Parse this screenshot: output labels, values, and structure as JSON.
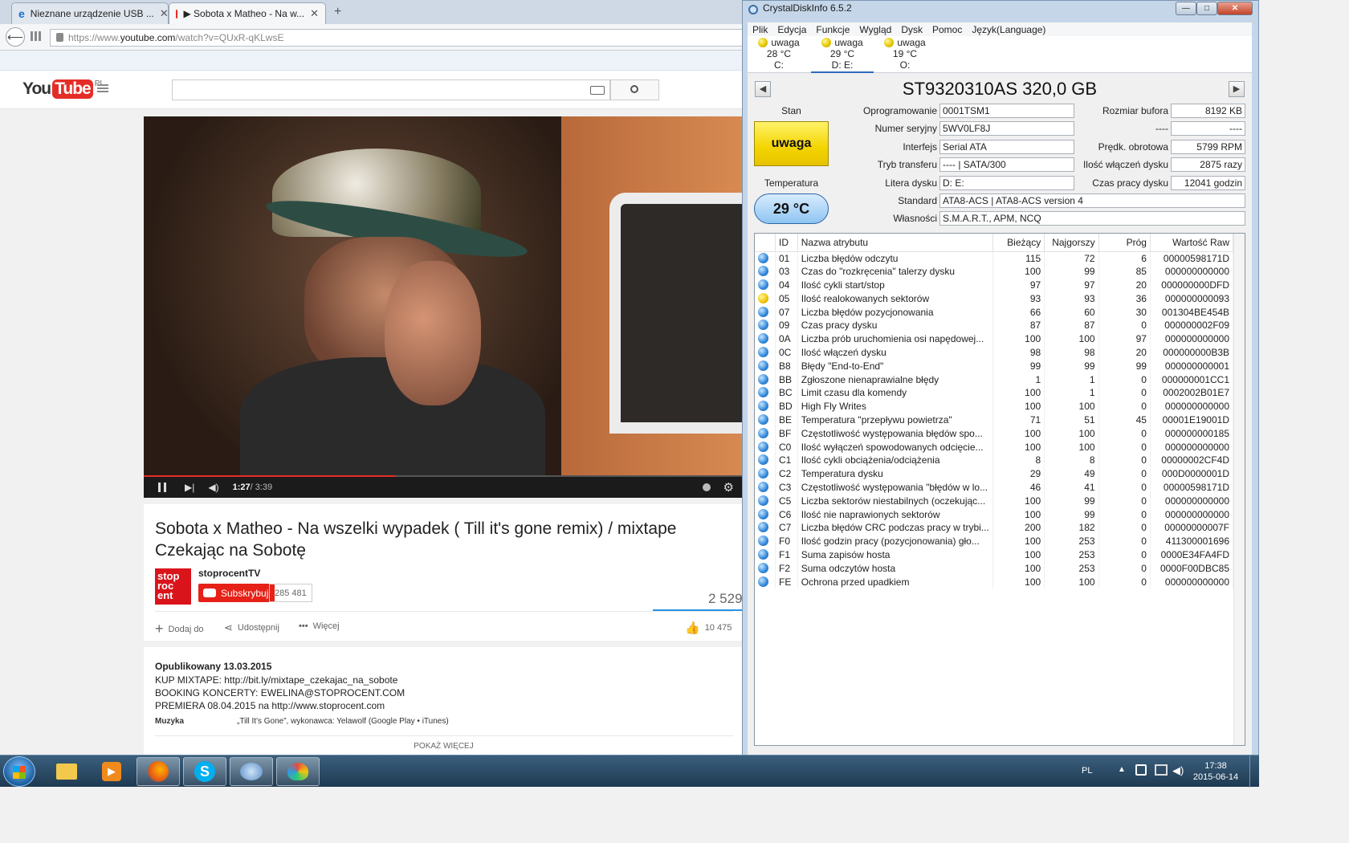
{
  "browser": {
    "tabs": [
      {
        "label": "Nieznane urządzenie USB ...",
        "close": "✕"
      },
      {
        "label": "▶ Sobota x Matheo - Na w...",
        "close": "✕"
      }
    ],
    "new_tab": "+",
    "url_prefix": "https://www.",
    "url_domain": "youtube.com",
    "url_path": "/watch?v=QUxR-qKLwsE"
  },
  "youtube": {
    "logo_you": "You",
    "logo_tube": "Tube",
    "logo_region": "PL",
    "time_current": "1:27",
    "time_total": " / 3:39",
    "progress": 0.42,
    "video_title": "Sobota x Matheo - Na wszelki wypadek ( Till it's gone remix) / mixtape Czekając na Sobotę",
    "channel_name": "stoprocentTV",
    "channel_logo": "stop roc ent",
    "subscribe_label": "Subskrybuj",
    "subscriber_count": "285 481",
    "views": "2 529",
    "add_label": "Dodaj do",
    "share_label": "Udostępnij",
    "more_label": "Więcej",
    "likes": "10 475",
    "published": "Opublikowany 13.03.2015",
    "desc_lines": [
      "KUP MIXTAPE: http://bit.ly/mixtape_czekajac_na_sobote",
      "BOOKING KONCERTY: EWELINA@STOPROCENT.COM",
      "PREMIERA 08.04.2015 na http://www.stoprocent.com"
    ],
    "music_label": "Muzyka",
    "music_value": "„Till It's Gone”, wykonawca: Yelawolf (Google Play • iTunes)",
    "show_more": "POKAŻ WIĘCEJ"
  },
  "cdi": {
    "title": "CrystalDiskInfo 6.5.2",
    "menu": [
      "Plik",
      "Edycja",
      "Funkcje",
      "Wygląd",
      "Dysk",
      "Pomoc",
      "Język(Language)"
    ],
    "drives": [
      {
        "status": "uwaga",
        "temp": "28 °C",
        "letter": "C:"
      },
      {
        "status": "uwaga",
        "temp": "29 °C",
        "letter": "D: E:"
      },
      {
        "status": "uwaga",
        "temp": "19 °C",
        "letter": "O:"
      }
    ],
    "disk_title": "ST9320310AS 320,0 GB",
    "stan_label": "Stan",
    "stan_value": "uwaga",
    "temp_label": "Temperatura",
    "temp_value": "29 °C",
    "fields": {
      "firmware_label": "Oprogramowanie",
      "firmware": "0001TSM1",
      "serial_label": "Numer seryjny",
      "serial": "5WV0LF8J",
      "interface_label": "Interfejs",
      "interface": "Serial ATA",
      "transfer_label": "Tryb transferu",
      "transfer": "---- | SATA/300",
      "letter_label": "Litera dysku",
      "letter": "D: E:",
      "standard_label": "Standard",
      "standard": "ATA8-ACS | ATA8-ACS version 4",
      "features_label": "Własności",
      "features": "S.M.A.R.T., APM, NCQ",
      "buffer_label": "Rozmiar bufora",
      "buffer": "8192 KB",
      "blank_label": "----",
      "blank": "----",
      "rpm_label": "Prędk. obrotowa",
      "rpm": "5799 RPM",
      "power_count_label": "Ilość włączeń dysku",
      "power_count": "2875 razy",
      "power_hours_label": "Czas pracy dysku",
      "power_hours": "12041 godzin"
    },
    "columns": [
      "ID",
      "Nazwa atrybutu",
      "Bieżący",
      "Najgorszy",
      "Próg",
      "Wartość Raw"
    ],
    "rows": [
      {
        "id": "01",
        "name": "Liczba błędów odczytu",
        "cur": "115",
        "worst": "72",
        "thr": "6",
        "raw": "00000598171D",
        "warn": false
      },
      {
        "id": "03",
        "name": "Czas do \"rozkręcenia\" talerzy dysku",
        "cur": "100",
        "worst": "99",
        "thr": "85",
        "raw": "000000000000",
        "warn": false
      },
      {
        "id": "04",
        "name": "Ilość cykli start/stop",
        "cur": "97",
        "worst": "97",
        "thr": "20",
        "raw": "000000000DFD",
        "warn": false
      },
      {
        "id": "05",
        "name": "Ilość realokowanych sektorów",
        "cur": "93",
        "worst": "93",
        "thr": "36",
        "raw": "000000000093",
        "warn": true
      },
      {
        "id": "07",
        "name": "Liczba błędów pozycjonowania",
        "cur": "66",
        "worst": "60",
        "thr": "30",
        "raw": "001304BE454B",
        "warn": false
      },
      {
        "id": "09",
        "name": "Czas pracy dysku",
        "cur": "87",
        "worst": "87",
        "thr": "0",
        "raw": "000000002F09",
        "warn": false
      },
      {
        "id": "0A",
        "name": "Liczba prób uruchomienia osi napędowej...",
        "cur": "100",
        "worst": "100",
        "thr": "97",
        "raw": "000000000000",
        "warn": false
      },
      {
        "id": "0C",
        "name": "Ilość włączeń dysku",
        "cur": "98",
        "worst": "98",
        "thr": "20",
        "raw": "000000000B3B",
        "warn": false
      },
      {
        "id": "B8",
        "name": "Błędy \"End-to-End\"",
        "cur": "99",
        "worst": "99",
        "thr": "99",
        "raw": "000000000001",
        "warn": false
      },
      {
        "id": "BB",
        "name": "Zgłoszone nienaprawialne błędy",
        "cur": "1",
        "worst": "1",
        "thr": "0",
        "raw": "000000001CC1",
        "warn": false
      },
      {
        "id": "BC",
        "name": "Limit czasu dla komendy",
        "cur": "100",
        "worst": "1",
        "thr": "0",
        "raw": "0002002B01E7",
        "warn": false
      },
      {
        "id": "BD",
        "name": "High Fly Writes",
        "cur": "100",
        "worst": "100",
        "thr": "0",
        "raw": "000000000000",
        "warn": false
      },
      {
        "id": "BE",
        "name": "Temperatura \"przepływu powietrza\"",
        "cur": "71",
        "worst": "51",
        "thr": "45",
        "raw": "00001E19001D",
        "warn": false
      },
      {
        "id": "BF",
        "name": "Częstotliwość występowania błędów spo...",
        "cur": "100",
        "worst": "100",
        "thr": "0",
        "raw": "000000000185",
        "warn": false
      },
      {
        "id": "C0",
        "name": "Ilość wyłączeń spowodowanych odcięcie...",
        "cur": "100",
        "worst": "100",
        "thr": "0",
        "raw": "000000000000",
        "warn": false
      },
      {
        "id": "C1",
        "name": "Ilość cykli obciążenia/odciążenia",
        "cur": "8",
        "worst": "8",
        "thr": "0",
        "raw": "00000002CF4D",
        "warn": false
      },
      {
        "id": "C2",
        "name": "Temperatura dysku",
        "cur": "29",
        "worst": "49",
        "thr": "0",
        "raw": "000D0000001D",
        "warn": false
      },
      {
        "id": "C3",
        "name": "Częstotliwość występowania \"błędów w lo...",
        "cur": "46",
        "worst": "41",
        "thr": "0",
        "raw": "00000598171D",
        "warn": false
      },
      {
        "id": "C5",
        "name": "Liczba sektorów niestabilnych (oczekując...",
        "cur": "100",
        "worst": "99",
        "thr": "0",
        "raw": "000000000000",
        "warn": false
      },
      {
        "id": "C6",
        "name": "Ilość nie naprawionych sektorów",
        "cur": "100",
        "worst": "99",
        "thr": "0",
        "raw": "000000000000",
        "warn": false
      },
      {
        "id": "C7",
        "name": "Liczba błędów CRC podczas pracy w trybi...",
        "cur": "200",
        "worst": "182",
        "thr": "0",
        "raw": "00000000007F",
        "warn": false
      },
      {
        "id": "F0",
        "name": "Ilość godzin pracy (pozycjonowania) gło...",
        "cur": "100",
        "worst": "253",
        "thr": "0",
        "raw": "411300001696",
        "warn": false
      },
      {
        "id": "F1",
        "name": "Suma zapisów hosta",
        "cur": "100",
        "worst": "253",
        "thr": "0",
        "raw": "0000E34FA4FD",
        "warn": false
      },
      {
        "id": "F2",
        "name": "Suma odczytów hosta",
        "cur": "100",
        "worst": "253",
        "thr": "0",
        "raw": "0000F00DBC85",
        "warn": false
      },
      {
        "id": "FE",
        "name": "Ochrona przed upadkiem",
        "cur": "100",
        "worst": "100",
        "thr": "0",
        "raw": "000000000000",
        "warn": false
      }
    ]
  },
  "taskbar": {
    "lang": "PL",
    "time": "17:38",
    "date": "2015-06-14"
  }
}
